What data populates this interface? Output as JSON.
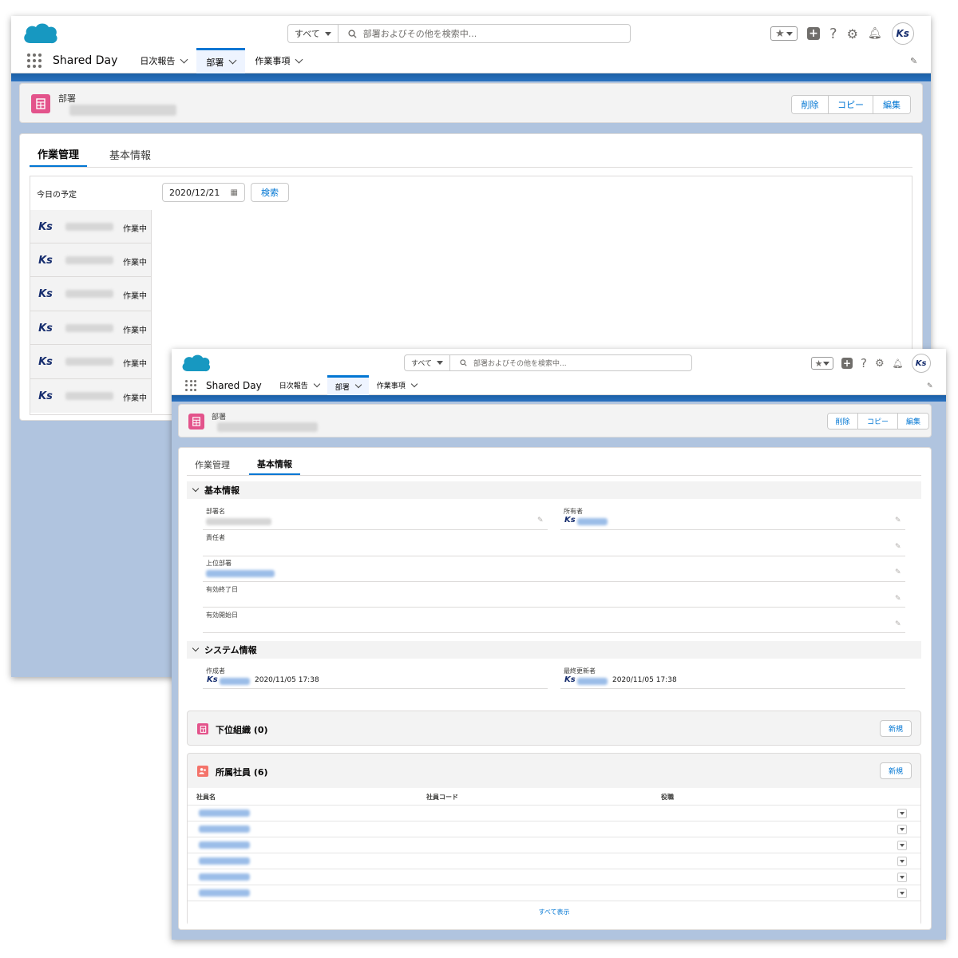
{
  "app": {
    "name": "Shared Day"
  },
  "search": {
    "scope": "すべて",
    "placeholder": "部署およびその他を検索中..."
  },
  "nav": {
    "items": [
      {
        "label": "日次報告",
        "active": false
      },
      {
        "label": "部署",
        "active": true
      },
      {
        "label": "作業事項",
        "active": false
      }
    ]
  },
  "header_icons": [
    "favorites-star-icon",
    "favorites-dropdown-icon",
    "global-add-icon",
    "help-icon",
    "setup-gear-icon",
    "notification-bell-icon",
    "user-avatar"
  ],
  "avatar_initials": "Ks",
  "record": {
    "object_label": "部署",
    "actions": [
      "削除",
      "コピー",
      "編集"
    ]
  },
  "tabs": [
    {
      "label": "作業管理"
    },
    {
      "label": "基本情報"
    }
  ],
  "work_tab": {
    "schedule_label": "今日の予定",
    "date_value": "2020/12/21",
    "search_button": "検索",
    "members": [
      {
        "status": "作業中"
      },
      {
        "status": "作業中"
      },
      {
        "status": "作業中"
      },
      {
        "status": "作業中"
      },
      {
        "status": "作業中"
      },
      {
        "status": "作業中"
      }
    ]
  },
  "detail_tab": {
    "section_basic": "基本情報",
    "fields": {
      "dept_name": "部署名",
      "owner": "所有者",
      "manager": "責任者",
      "parent_dept": "上位部署",
      "valid_end": "有効終了日",
      "valid_start": "有効開始日"
    },
    "section_system": "システム情報",
    "system": {
      "created_by": "作成者",
      "created_at": "2020/11/05 17:38",
      "modified_by": "最終更新者",
      "modified_at": "2020/11/05 17:38"
    },
    "related_sub_org": {
      "title": "下位組織 (0)",
      "new_button": "新規"
    },
    "related_members": {
      "title": "所属社員 (6)",
      "new_button": "新規",
      "columns": [
        "社員名",
        "社員コード",
        "役職"
      ],
      "rows": 6,
      "view_all": "すべて表示"
    }
  },
  "colors": {
    "brand": "#0176d3",
    "record_icon": "#e3538b",
    "member_icon": "#f4736a",
    "cloud": "#1798c1"
  }
}
